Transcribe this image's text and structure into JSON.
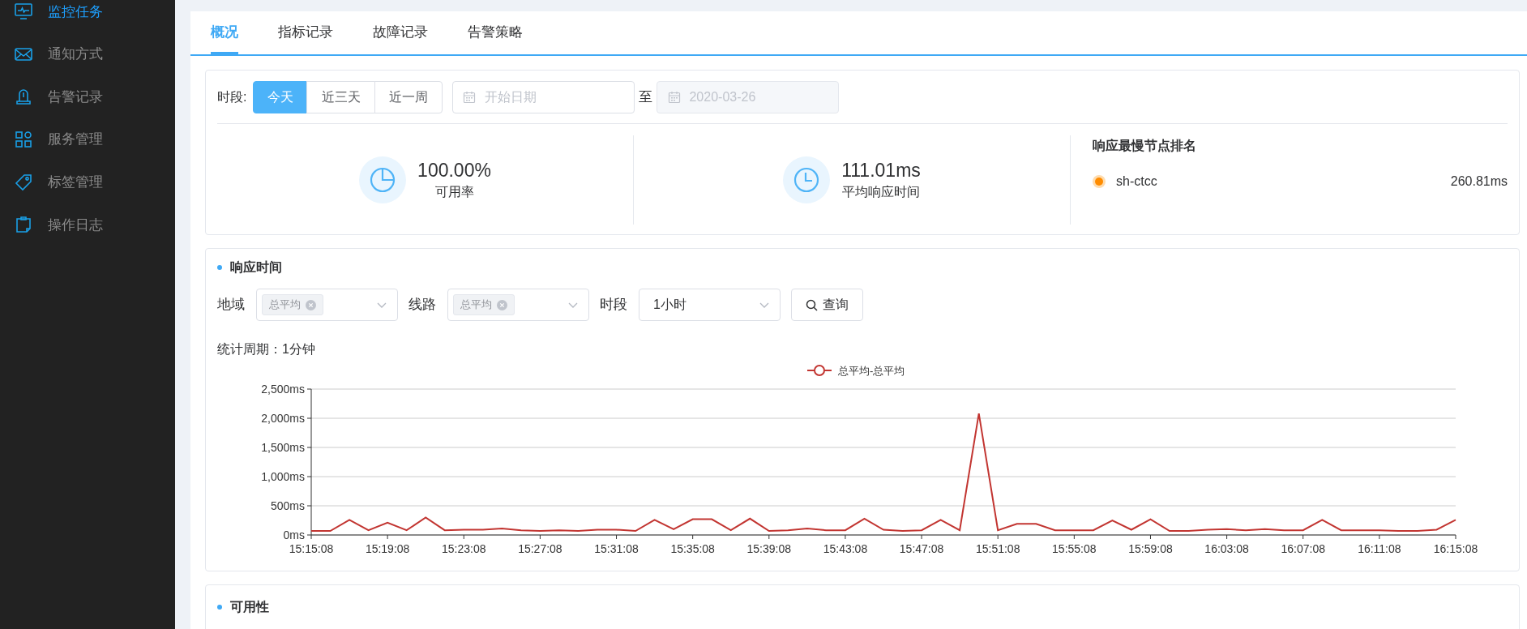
{
  "sidebar": {
    "items": [
      {
        "label": "监控任务",
        "selected": true
      },
      {
        "label": "通知方式",
        "selected": false
      },
      {
        "label": "告警记录",
        "selected": false
      },
      {
        "label": "服务管理",
        "selected": false
      },
      {
        "label": "标签管理",
        "selected": false
      },
      {
        "label": "操作日志",
        "selected": false
      }
    ]
  },
  "tabs": [
    {
      "label": "概况",
      "selected": true
    },
    {
      "label": "指标记录",
      "selected": false
    },
    {
      "label": "故障记录",
      "selected": false
    },
    {
      "label": "告警策略",
      "selected": false
    }
  ],
  "overview": {
    "period_label": "时段:",
    "range_buttons": [
      {
        "label": "今天",
        "selected": true
      },
      {
        "label": "近三天",
        "selected": false
      },
      {
        "label": "近一周",
        "selected": false
      }
    ],
    "start_date": {
      "placeholder": "开始日期"
    },
    "separator": "至",
    "end_date": {
      "value": "2020-03-26",
      "disabled": true
    },
    "stats": [
      {
        "value": "100.00%",
        "label": "可用率"
      },
      {
        "value": "111.01ms",
        "label": "平均响应时间"
      }
    ],
    "ranking": {
      "title": "响应最慢节点排名",
      "items": [
        {
          "name": "sh-ctcc",
          "value": "260.81ms",
          "color": "#ff8c00"
        }
      ]
    }
  },
  "response_time": {
    "title": "响应时间",
    "filters": [
      {
        "kind": "tags",
        "label": "地域",
        "tags": [
          "总平均"
        ]
      },
      {
        "kind": "tags",
        "label": "线路",
        "tags": [
          "总平均"
        ]
      },
      {
        "kind": "select",
        "label": "时段",
        "value": "1小时"
      }
    ],
    "query_button": "查询",
    "period_note": "统计周期：1分钟",
    "chart_data": {
      "type": "line",
      "grid": true,
      "series": [
        {
          "name": "总平均-总平均",
          "color": "#c23531",
          "values": [
            70,
            70,
            260,
            80,
            210,
            80,
            300,
            80,
            90,
            90,
            110,
            80,
            70,
            80,
            70,
            90,
            90,
            70,
            260,
            100,
            270,
            270,
            80,
            280,
            70,
            80,
            110,
            80,
            80,
            280,
            90,
            70,
            80,
            260,
            80,
            2080,
            80,
            190,
            190,
            80,
            80,
            80,
            250,
            90,
            270,
            70,
            70,
            90,
            100,
            80,
            100,
            80,
            80,
            260,
            80,
            80,
            80,
            70,
            70,
            90,
            260
          ]
        }
      ],
      "ylim": [
        0,
        2500
      ],
      "yticks": [
        {
          "value": 0,
          "label": "0ms"
        },
        {
          "value": 500,
          "label": "500ms"
        },
        {
          "value": 1000,
          "label": "1,000ms"
        },
        {
          "value": 1500,
          "label": "1,500ms"
        },
        {
          "value": 2000,
          "label": "2,000ms"
        },
        {
          "value": 2500,
          "label": "2,500ms"
        }
      ]
    },
    "x_axis_labels": [
      "15:15:08",
      "15:19:08",
      "15:23:08",
      "15:27:08",
      "15:31:08",
      "15:35:08",
      "15:39:08",
      "15:43:08",
      "15:47:08",
      "15:51:08",
      "15:55:08",
      "15:59:08",
      "16:03:08",
      "16:07:08",
      "16:11:08",
      "16:15:08"
    ]
  },
  "availability": {
    "title": "可用性"
  }
}
